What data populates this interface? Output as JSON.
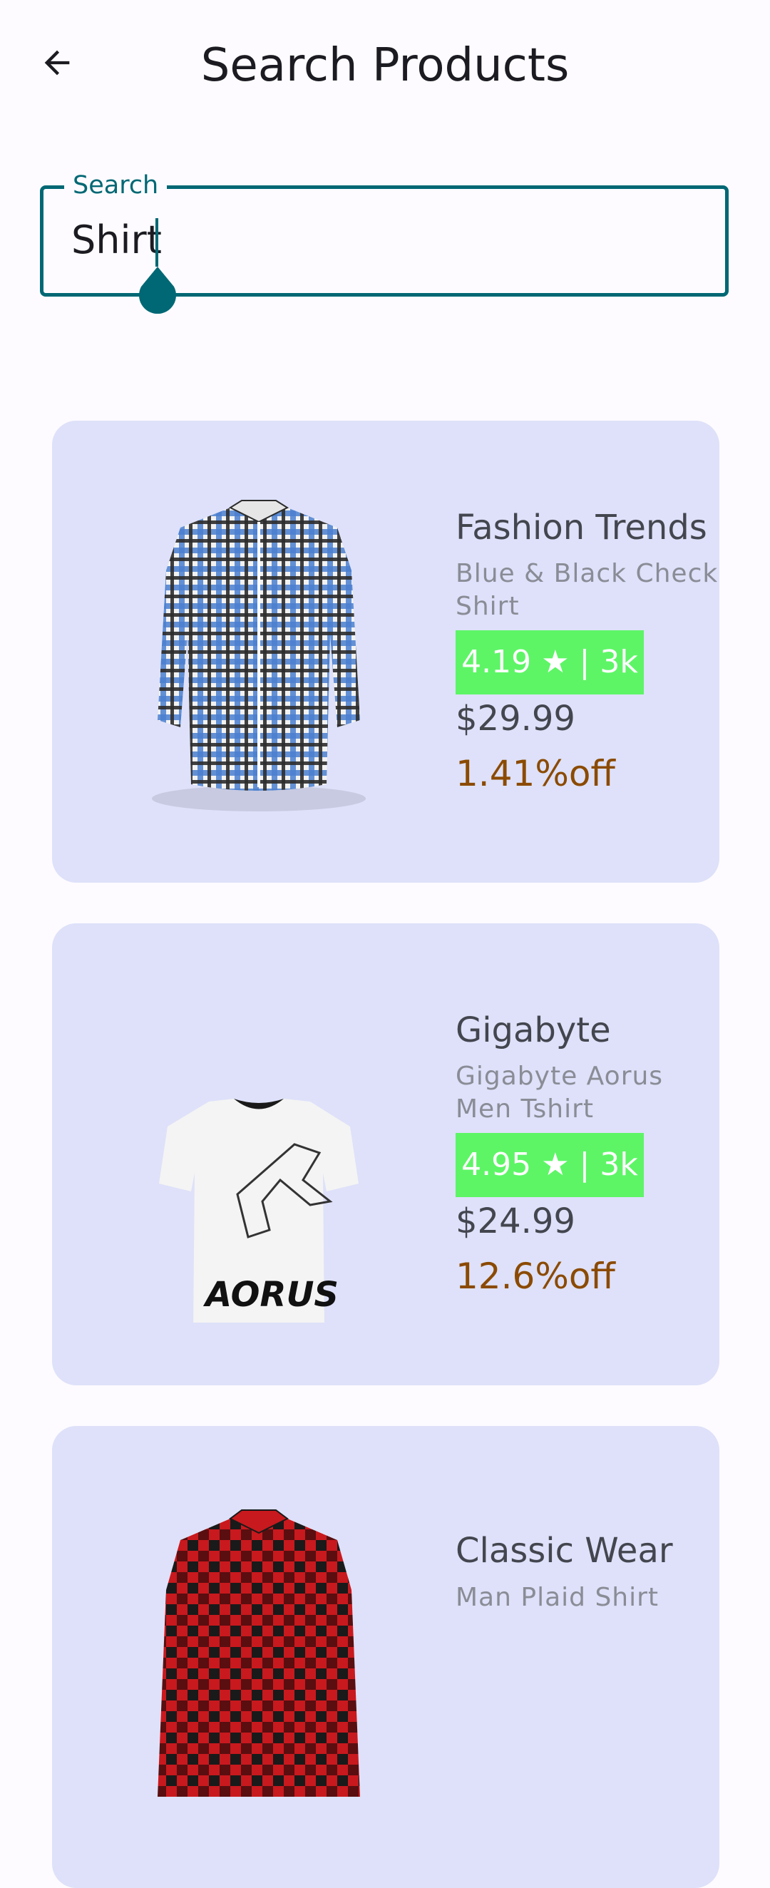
{
  "header": {
    "title": "Search Products"
  },
  "search": {
    "label": "Search",
    "value": "Shirt"
  },
  "colors": {
    "primary": "#006874",
    "card_bg": "#dee1f9",
    "rating_bg": "#5df566",
    "discount": "#8b4a00"
  },
  "products": [
    {
      "brand": "Fashion Trends",
      "name": "Blue & Black Check Shirt",
      "rating": "4.19 ★ | 3k",
      "price": "$29.99",
      "discount": "1.41%off"
    },
    {
      "brand": "Gigabyte",
      "name": "Gigabyte Aorus Men Tshirt",
      "rating": "4.95 ★ | 3k",
      "price": "$24.99",
      "discount": "12.6%off"
    },
    {
      "brand": "Classic Wear",
      "name": "Man Plaid Shirt"
    }
  ]
}
